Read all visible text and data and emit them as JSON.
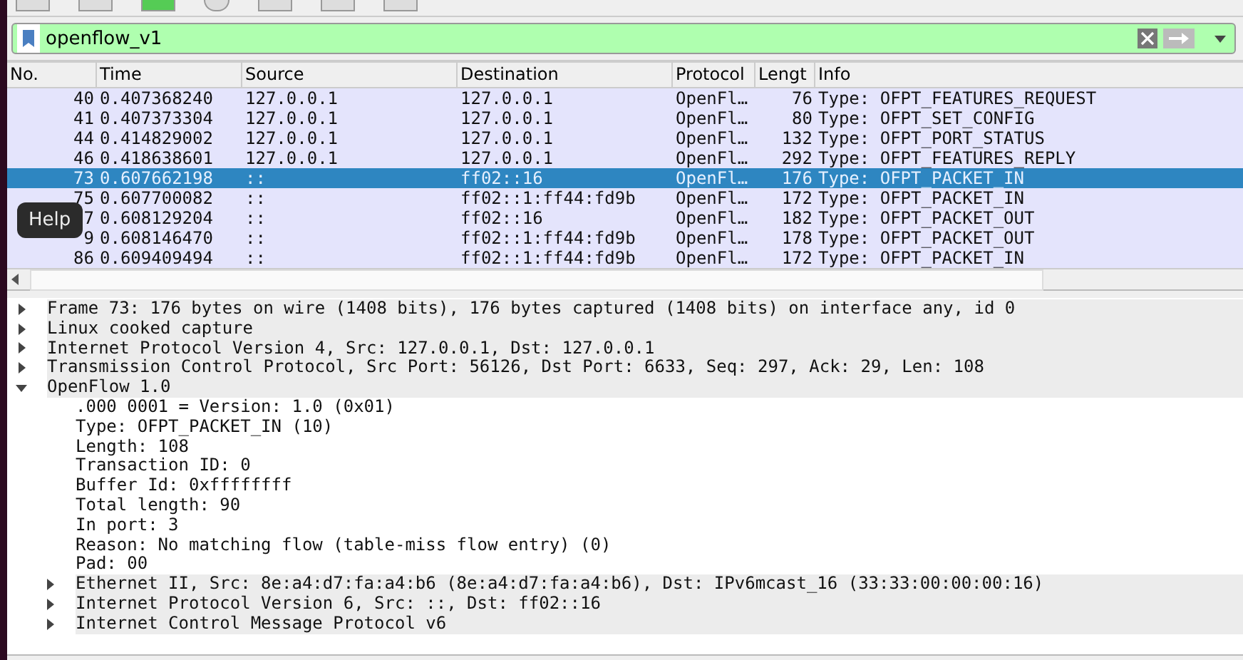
{
  "filter": {
    "value": "openflow_v1"
  },
  "columns": [
    "No.",
    "Time",
    "Source",
    "Destination",
    "Protocol",
    "Lengt",
    "Info"
  ],
  "packets": [
    {
      "no": "40",
      "time": "0.407368240",
      "source": "127.0.0.1",
      "destination": "127.0.0.1",
      "protocol": "OpenFl…",
      "length": "76",
      "info": "Type: OFPT_FEATURES_REQUEST",
      "selected": false
    },
    {
      "no": "41",
      "time": "0.407373304",
      "source": "127.0.0.1",
      "destination": "127.0.0.1",
      "protocol": "OpenFl…",
      "length": "80",
      "info": "Type: OFPT_SET_CONFIG",
      "selected": false
    },
    {
      "no": "44",
      "time": "0.414829002",
      "source": "127.0.0.1",
      "destination": "127.0.0.1",
      "protocol": "OpenFl…",
      "length": "132",
      "info": "Type: OFPT_PORT_STATUS",
      "selected": false
    },
    {
      "no": "46",
      "time": "0.418638601",
      "source": "127.0.0.1",
      "destination": "127.0.0.1",
      "protocol": "OpenFl…",
      "length": "292",
      "info": "Type: OFPT_FEATURES_REPLY",
      "selected": false
    },
    {
      "no": "73",
      "time": "0.607662198",
      "source": "::",
      "destination": "ff02::16",
      "protocol": "OpenFl…",
      "length": "176",
      "info": "Type: OFPT_PACKET_IN",
      "selected": true
    },
    {
      "no": "75",
      "time": "0.607700082",
      "source": "::",
      "destination": "ff02::1:ff44:fd9b",
      "protocol": "OpenFl…",
      "length": "172",
      "info": "Type: OFPT_PACKET_IN",
      "selected": false
    },
    {
      "no": "7",
      "time": "0.608129204",
      "source": "::",
      "destination": "ff02::16",
      "protocol": "OpenFl…",
      "length": "182",
      "info": "Type: OFPT_PACKET_OUT",
      "selected": false
    },
    {
      "no": "9",
      "time": "0.608146470",
      "source": "::",
      "destination": "ff02::1:ff44:fd9b",
      "protocol": "OpenFl…",
      "length": "178",
      "info": "Type: OFPT_PACKET_OUT",
      "selected": false
    },
    {
      "no": "86",
      "time": "0.609409494",
      "source": "::",
      "destination": "ff02::1:ff44:fd9b",
      "protocol": "OpenFl…",
      "length": "172",
      "info": "Type: OFPT_PACKET_IN",
      "selected": false
    }
  ],
  "tooltip": "Help",
  "details": [
    {
      "text": "Frame 73: 176 bytes on wire (1408 bits), 176 bytes captured (1408 bits) on interface any, id 0",
      "expanded": false
    },
    {
      "text": "Linux cooked capture",
      "expanded": false
    },
    {
      "text": "Internet Protocol Version 4, Src: 127.0.0.1, Dst: 127.0.0.1",
      "expanded": false
    },
    {
      "text": "Transmission Control Protocol, Src Port: 56126, Dst Port: 6633, Seq: 297, Ack: 29, Len: 108",
      "expanded": false
    },
    {
      "text": "OpenFlow 1.0",
      "expanded": true,
      "children": [
        {
          "text": ".000 0001 = Version: 1.0 (0x01)"
        },
        {
          "text": "Type: OFPT_PACKET_IN (10)"
        },
        {
          "text": "Length: 108"
        },
        {
          "text": "Transaction ID: 0"
        },
        {
          "text": "Buffer Id: 0xffffffff"
        },
        {
          "text": "Total length: 90"
        },
        {
          "text": "In port: 3"
        },
        {
          "text": "Reason: No matching flow (table-miss flow entry) (0)"
        },
        {
          "text": "Pad: 00"
        },
        {
          "text": "Ethernet II, Src: 8e:a4:d7:fa:a4:b6 (8e:a4:d7:fa:a4:b6), Dst: IPv6mcast_16 (33:33:00:00:00:16)",
          "expanded": false
        },
        {
          "text": "Internet Protocol Version 6, Src: ::, Dst: ff02::16",
          "expanded": false
        },
        {
          "text": "Internet Control Message Protocol v6",
          "expanded": false
        }
      ]
    }
  ]
}
